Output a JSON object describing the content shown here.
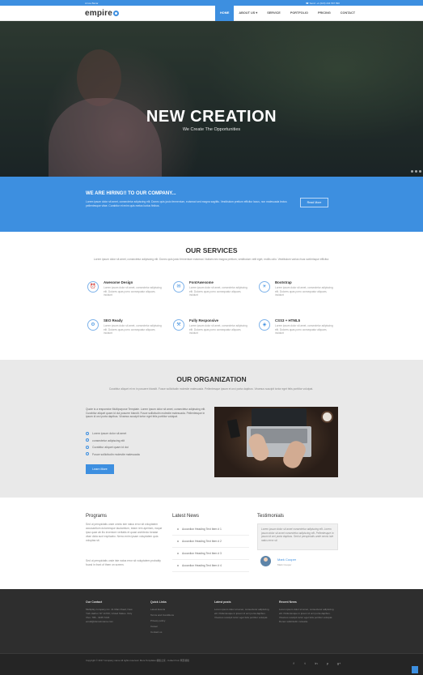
{
  "topbar": {
    "left": "Arrow Bazar",
    "right": "☎ Send: +1 (023) 234 567 890"
  },
  "brand": {
    "logo": "empire",
    "accent": "#3d8fe0"
  },
  "nav": [
    {
      "label": "HOME",
      "active": true
    },
    {
      "label": "ABOUT US ▾",
      "active": false
    },
    {
      "label": "SERVICE",
      "active": false
    },
    {
      "label": "PORTFOLIO",
      "active": false
    },
    {
      "label": "PRICING",
      "active": false
    },
    {
      "label": "CONTACT",
      "active": false
    }
  ],
  "hero": {
    "title": "NEW CREATION",
    "subtitle": "We Create The Opportunities"
  },
  "hiring": {
    "title": "WE ARE HIRING!! TO OUR COMPANY...",
    "text": "Lorem ipsum dolor sit amet, consectetur adipiscing elit. Donec quis justo fermentum, euismod sed magna sagittis. Vestibulum pretium efficitur lacus, non malesuada lectus pellentesque vitae. Curabitur et enim quis metus luctus finibus.",
    "button": "Read More"
  },
  "services": {
    "title": "OUR SERVICES",
    "description": "Lorem ipsum dolor sit amet, consectetur adipiscing elit. Donec quis justo fermentum euismod. Nullam nec magna pretium, vestibulum velit eget, mollis odio. Vestibulum varius risus scelerisque efficitur.",
    "items": [
      {
        "icon": "⏰",
        "icon_name": "alarm-icon",
        "title": "Awesome Design",
        "text": "Lorem ipsum dolor sit amet, consectetur adipiscing elit. Dolores quas porro consequatur aliquam, incidunt"
      },
      {
        "icon": "✉",
        "icon_name": "envelope-icon",
        "title": "FontAwesome",
        "text": "Lorem ipsum dolor sit amet, consectetur adipiscing elit. Dolores quas porro consequatur aliquam, incidunt"
      },
      {
        "icon": "☀",
        "icon_name": "bulb-icon",
        "title": "Bootstrap",
        "text": "Lorem ipsum dolor sit amet, consectetur adipiscing elit. Dolores quas porro consequatur aliquam, incidunt"
      },
      {
        "icon": "⚙",
        "icon_name": "gear-icon",
        "title": "SEO Ready",
        "text": "Lorem ipsum dolor sit amet, consectetur adipiscing elit. Dolores quas porro consequatur aliquam, incidunt"
      },
      {
        "icon": "⚒",
        "icon_name": "tools-icon",
        "title": "Fully Responsive",
        "text": "Lorem ipsum dolor sit amet, consectetur adipiscing elit. Dolores quas porro consequatur aliquam, incidunt"
      },
      {
        "icon": "◈",
        "icon_name": "css3-icon",
        "title": "CSS3 + HTML5",
        "text": "Lorem ipsum dolor sit amet, consectetur adipiscing elit. Dolores quas porro consequatur aliquam, incidunt"
      }
    ]
  },
  "organization": {
    "title": "OUR ORGANIZATION",
    "description": "Curabitur aliquet et ex in posuere blandit. Fusce sollicitudin molestie malesuada. Pellentesque ipsum et orci porta dapibus. Vivamus suscipit tortor eget felis porttitor volutpat.",
    "text": "Quote is a responsive Multipurpose Template. Lorem ipsum dolor sit amet, consectetur adipiscing elit. Curabitur aliquet quam id dui posuere blandit. Fusce sollicitudin molestie malesuada. Pellentesque in ipsum id orci porta dapibus. Vivamus suscipit tortor eget felis porttitor volutpat.",
    "list": [
      "Lorem ipsum dolor sit amet",
      "consectetur adipiscing elit",
      "Curabitur aliquet quam id dui",
      "Fusce sollicitudin molestie malesuada"
    ],
    "button": "Learn More"
  },
  "programs": {
    "title": "Programs",
    "text1": "Sed ut perspiciatis unde omnis iste natus error sit voluptatem accusantium doloremque laudantium, totam rem aperiam, eaque ipsa quae ab illo inventore veritatis et quasi architecto beatae vitae dicta sunt explicabo. Nemo enim ipsam voluptatem quia voluptas sit.",
    "text2": "Sed ut perspiciatis unde iste natus error sit voluptatem probably found in front of them on screen."
  },
  "news": {
    "title": "Latest News",
    "items": [
      "Accordion Heading Text Item # 1",
      "Accordion Heading Text Item # 2",
      "Accordion Heading Text Item # 3",
      "Accordion Heading Text Item # 4"
    ]
  },
  "testimonials": {
    "title": "Testimonials",
    "quote": "Lorem ipsum dolor sit amet consectetur adipiscing elit. Lorem ipsum dolor sit amet consectetur adipiscing elit. Pellentesque in ipsum id orci porta dapibus. Sed ut perspiciatis unde omnis iste natus error sit.",
    "name": "Mark Cooper",
    "role": "Mark Cooper"
  },
  "footer": {
    "contact_title": "Our Contact",
    "contact_text": "Multiplay company inc. 41 Main Road, New York Harbor NY 11700, United States. Only Vivo: 786 - 3245 7222 email@domainname.com",
    "links_title": "Quick Links",
    "links": [
      "Latest Events",
      "Terms and Conditions",
      "Privacy policy",
      "Career",
      "Contact us"
    ],
    "latest_title": "Latest posts",
    "latest_text": "Lorem ipsum dolor sit amet, consectetur adipiscing elit. Pellentesque in ipsum id orci porta dapibus. Vivamus suscipit tortor eget felis porttitor volutpat.",
    "recent_title": "Recent News",
    "recent_text": "Lorem ipsum dolor sit amet, consectetur adipiscing elit. Pellentesque in ipsum id orci porta dapibus. Vivamus suscipit tortor eget felis porttitor volutpat. Donec sollicitudin molestie.",
    "copyright": "Copyright © 2017 Company name All rights reserved. More Templates 模板之家 - Collect from 网页模板",
    "social": [
      {
        "glyph": "f",
        "name": "facebook-icon"
      },
      {
        "glyph": "t",
        "name": "twitter-icon"
      },
      {
        "glyph": "in",
        "name": "linkedin-icon"
      },
      {
        "glyph": "p",
        "name": "pinterest-icon"
      },
      {
        "glyph": "g+",
        "name": "google-plus-icon"
      }
    ]
  }
}
